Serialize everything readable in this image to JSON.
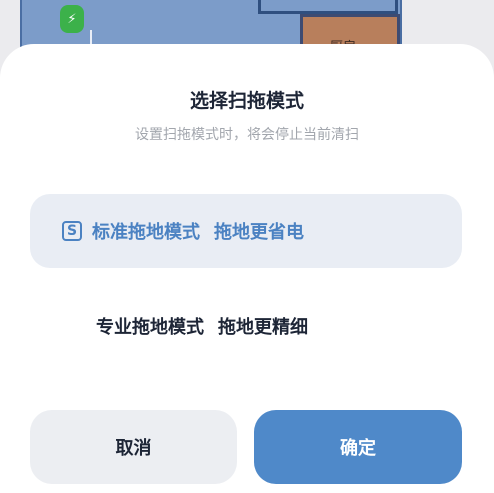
{
  "background_map": {
    "room_label": "厨房",
    "dock_icon": "bolt-icon"
  },
  "sheet": {
    "title": "选择扫拖模式",
    "subtitle": "设置扫拖模式时，将会停止当前清扫",
    "options": [
      {
        "name": "标准拖地模式",
        "desc": "拖地更省电",
        "selected": true,
        "icon": "s-mode-icon",
        "icon_glyph": "S"
      },
      {
        "name": "专业拖地模式",
        "desc": "拖地更精细",
        "selected": false
      }
    ],
    "cancel_label": "取消",
    "confirm_label": "确定"
  },
  "colors": {
    "accent": "#4f89c9",
    "selected_bg": "#e9edf4",
    "title_text": "#1d2536",
    "subtitle_text": "#a2a6ad"
  }
}
